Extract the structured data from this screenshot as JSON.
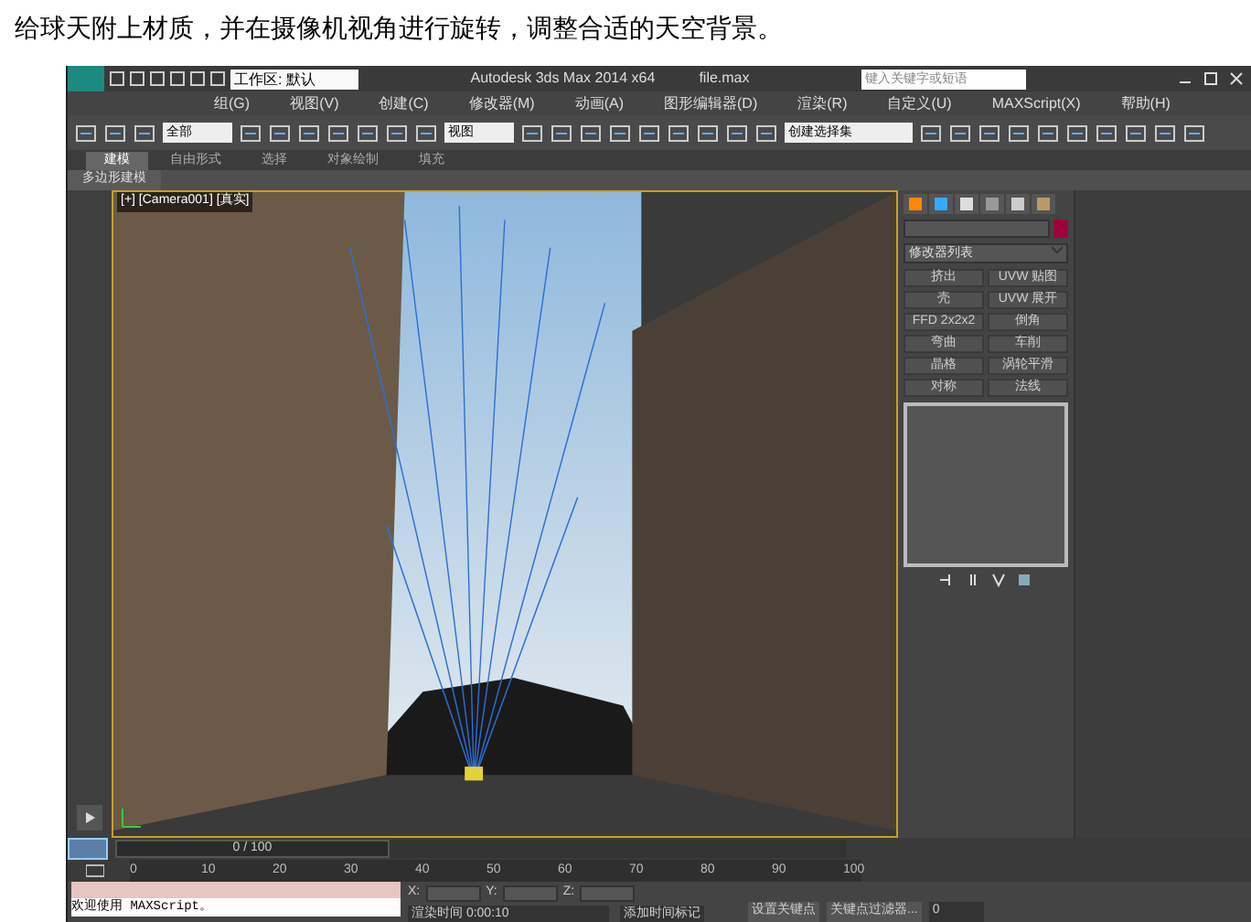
{
  "caption": "给球天附上材质，并在摄像机视角进行旋转，调整合适的天空背景。",
  "title_bar": {
    "workspace": "工作区: 默认",
    "title": "Autodesk 3ds Max  2014 x64",
    "file": "file.max",
    "search_placeholder": "键入关键字或短语"
  },
  "menu": [
    "组(G)",
    "视图(V)",
    "创建(C)",
    "修改器(M)",
    "动画(A)",
    "图形编辑器(D)",
    "渲染(R)",
    "自定义(U)",
    "MAXScript(X)",
    "帮助(H)"
  ],
  "toolbar": {
    "filter": "全部",
    "coord": "视图",
    "selection_set": "创建选择集"
  },
  "ribbon_tabs": [
    {
      "label": "建模",
      "selected": true
    },
    {
      "label": "自由形式",
      "selected": false
    },
    {
      "label": "选择",
      "selected": false
    },
    {
      "label": "对象绘制",
      "selected": false
    },
    {
      "label": "填充",
      "selected": false
    }
  ],
  "ribbon_panel": "多边形建模",
  "viewport": {
    "label": "[+] [Camera001] [真实]"
  },
  "command_panel": {
    "modifier_list": "修改器列表",
    "modifiers": [
      "挤出",
      "UVW 贴图",
      "壳",
      "UVW 展开",
      "FFD 2x2x2",
      "倒角",
      "弯曲",
      "车削",
      "晶格",
      "涡轮平滑",
      "对称",
      "法线"
    ]
  },
  "timeline": {
    "frame": "0 / 100",
    "level": 0,
    "ticks": [
      "0",
      "10",
      "20",
      "30",
      "40",
      "50",
      "60",
      "70",
      "80",
      "90",
      "100"
    ]
  },
  "status": {
    "welcome": "欢迎使用 MAXScript。",
    "x": "X:",
    "y": "Y:",
    "z": "Z:",
    "render_time": "渲染时间  0:00:10",
    "add_tag": "添加时间标记",
    "set_key": "设置关键点",
    "key_filter": "关键点过滤器...",
    "frame_value": "0"
  }
}
